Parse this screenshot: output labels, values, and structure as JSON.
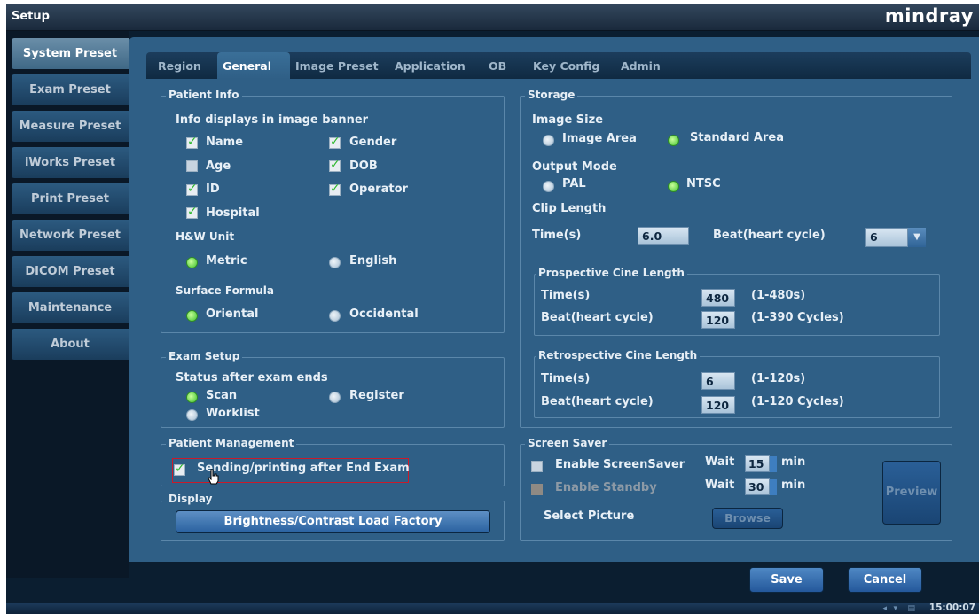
{
  "app": {
    "title": "Setup",
    "logo": "mindray"
  },
  "sidebar": {
    "items": [
      "System Preset",
      "Exam Preset",
      "Measure Preset",
      "iWorks Preset",
      "Print Preset",
      "Network Preset",
      "DICOM Preset",
      "Maintenance",
      "About"
    ]
  },
  "tabs": [
    "Region",
    "General",
    "Image Preset",
    "Application",
    "OB",
    "Key Config",
    "Admin"
  ],
  "patient_info": {
    "title": "Patient Info",
    "banner_label": "Info displays in image banner",
    "checkboxes": [
      {
        "label": "Name",
        "checked": true
      },
      {
        "label": "Gender",
        "checked": true
      },
      {
        "label": "Age",
        "checked": false
      },
      {
        "label": "DOB",
        "checked": true
      },
      {
        "label": "ID",
        "checked": true
      },
      {
        "label": "Operator",
        "checked": true
      },
      {
        "label": "Hospital",
        "checked": true
      }
    ],
    "hw_unit": {
      "label": "H&W Unit",
      "options": [
        "Metric",
        "English"
      ],
      "selected": "Metric"
    },
    "surface_formula": {
      "label": "Surface Formula",
      "options": [
        "Oriental",
        "Occidental"
      ],
      "selected": "Oriental"
    }
  },
  "exam_setup": {
    "title": "Exam Setup",
    "status_label": "Status after exam ends",
    "options": [
      "Scan",
      "Register",
      "Worklist"
    ],
    "selected": "Scan"
  },
  "patient_management": {
    "title": "Patient Management",
    "sending_label": "Sending/printing after End Exam",
    "checked": true
  },
  "display": {
    "title": "Display",
    "button": "Brightness/Contrast Load Factory"
  },
  "storage": {
    "title": "Storage",
    "image_size_label": "Image Size",
    "image_size_options": [
      "Image Area",
      "Standard Area"
    ],
    "image_size_selected": "Standard Area",
    "output_mode_label": "Output Mode",
    "output_mode_options": [
      "PAL",
      "NTSC"
    ],
    "output_mode_selected": "NTSC",
    "clip_length_label": "Clip Length",
    "time_label": "Time(s)",
    "time_value": "6.0",
    "beat_label": "Beat(heart cycle)",
    "beat_value": "6",
    "prospective": {
      "title": "Prospective Cine Length",
      "time_label": "Time(s)",
      "time_value": "480",
      "time_range": "(1-480s)",
      "beat_label": "Beat(heart cycle)",
      "beat_value": "120",
      "beat_range": "(1-390 Cycles)"
    },
    "retrospective": {
      "title": "Retrospective Cine Length",
      "time_label": "Time(s)",
      "time_value": "6",
      "time_range": "(1-120s)",
      "beat_label": "Beat(heart cycle)",
      "beat_value": "120",
      "beat_range": "(1-120 Cycles)"
    }
  },
  "screen_saver": {
    "title": "Screen Saver",
    "enable_label": "Enable ScreenSaver",
    "enable_checked": false,
    "standby_label": "Enable Standby",
    "standby_checked": false,
    "wait_label": "Wait",
    "wait1_value": "15",
    "wait2_value": "30",
    "min_label": "min",
    "select_picture_label": "Select Picture",
    "browse_label": "Browse",
    "preview_label": "Preview"
  },
  "footer": {
    "save": "Save",
    "cancel": "Cancel"
  },
  "status": {
    "time": "15:00:07"
  },
  "colors": {
    "accent": "#2f5f86",
    "button": "#2a62a0",
    "highlight": "#c81b2b",
    "check": "#2db82d"
  }
}
